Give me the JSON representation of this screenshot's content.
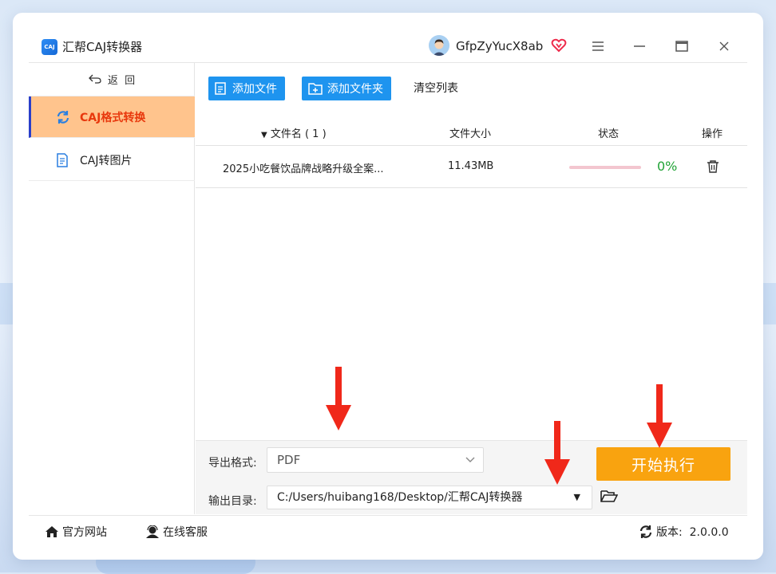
{
  "app": {
    "logo_text": "CAJ",
    "title": "汇帮CAJ转换器"
  },
  "user": {
    "name": "GfpZyYucX8ab"
  },
  "window_controls": {
    "menu": "≡",
    "minimize": "—",
    "maximize": "□",
    "close": "×"
  },
  "sidebar": {
    "back_label": "返  回",
    "items": [
      {
        "label": "CAJ格式转换",
        "active": true
      },
      {
        "label": "CAJ转图片",
        "active": false
      }
    ]
  },
  "toolbar": {
    "add_file": "添加文件",
    "add_folder": "添加文件夹",
    "clear_list": "清空列表"
  },
  "table": {
    "columns": {
      "name": "文件名 ( 1 )",
      "size": "文件大小",
      "status": "状态",
      "action": "操作"
    },
    "rows": [
      {
        "name": "2025小吃餐饮品牌战略升级全案...",
        "size": "11.43MB",
        "progress": 0,
        "progress_text": "0%"
      }
    ]
  },
  "output": {
    "format_label": "导出格式:",
    "format_value": "PDF",
    "dir_label": "输出目录:",
    "dir_value": "C:/Users/huibang168/Desktop/汇帮CAJ转换器",
    "start_label": "开始执行"
  },
  "footer": {
    "website": "官方网站",
    "support": "在线客服",
    "version": "版本:  2.0.0.0"
  },
  "colors": {
    "accent_blue": "#1e94ef",
    "active_nav_bg": "#ffc48d",
    "active_nav_text": "#e8380d",
    "start_button": "#f9a30f",
    "progress_text": "#21a336",
    "annotation_arrow": "#f0281a"
  }
}
